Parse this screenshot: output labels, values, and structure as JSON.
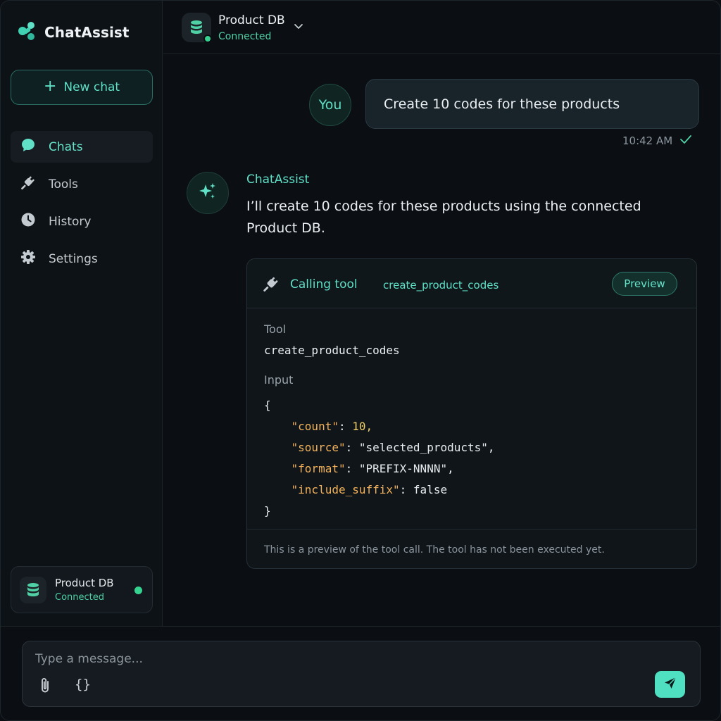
{
  "app": {
    "name": "ChatAssist"
  },
  "sidebar": {
    "new_chat_label": "New chat",
    "items": [
      {
        "label": "Chats",
        "icon": "chat-bubble-icon",
        "active": true
      },
      {
        "label": "Tools",
        "icon": "plug-icon",
        "active": false
      },
      {
        "label": "History",
        "icon": "clock-icon",
        "active": false
      },
      {
        "label": "Settings",
        "icon": "gear-icon",
        "active": false
      }
    ],
    "connection": {
      "title": "Product DB",
      "status": "Connected"
    }
  },
  "header": {
    "title": "Product DB",
    "status": "Connected"
  },
  "conversation": {
    "user": {
      "avatar_label": "You",
      "text": "Create 10 codes for these products",
      "time": "10:42 AM"
    },
    "assistant": {
      "name": "ChatAssist",
      "text": "I’ll create 10 codes for these products using the connected Product DB."
    }
  },
  "tool_call": {
    "calling_label": "Calling tool",
    "tool_name": "create_product_codes",
    "preview_label": "Preview",
    "tool_label": "Tool",
    "tool_value": "create_product_codes",
    "input_label": "Input",
    "input_lines": [
      "{",
      "    \"count\": 10,",
      "    \"source\": \"selected_products\",",
      "    \"format\": \"PREFIX-NNNN\",",
      "    \"include_suffix\": false",
      "}"
    ],
    "input": {
      "count": 10,
      "source": "selected_products",
      "format": "PREFIX-NNNN",
      "include_suffix": false
    },
    "footer_note": "This is a preview of the tool call. The tool has not been executed yet."
  },
  "composer": {
    "placeholder": "Type a message...",
    "code_button_label": "{}"
  },
  "colors": {
    "accent": "#5fe0c7",
    "connected": "#36d28f",
    "background": "#0b0f13"
  }
}
